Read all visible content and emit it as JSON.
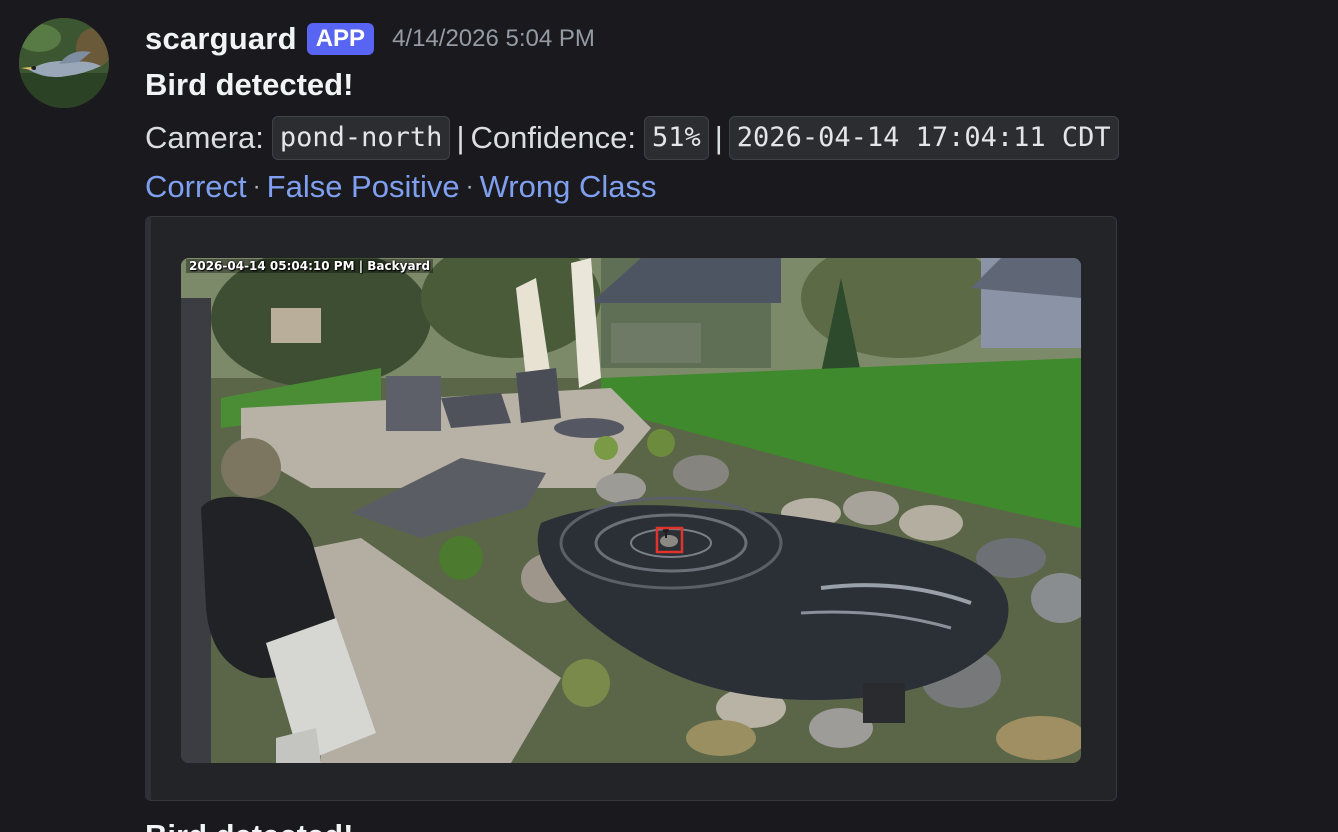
{
  "author": {
    "username": "scarguard",
    "badge": "APP",
    "timestamp": "4/14/2026 5:04 PM",
    "avatar_icon": "heron-avatar"
  },
  "message": {
    "title": "Bird detected!",
    "camera_label": "Camera:",
    "camera_value": "pond-north",
    "separator": "|",
    "confidence_label": "Confidence:",
    "confidence_value": "51%",
    "datetime_value": "2026-04-14 17:04:11 CDT",
    "links": {
      "correct": "Correct",
      "false_positive": "False Positive",
      "wrong_class": "Wrong Class",
      "dot": "·"
    }
  },
  "embed": {
    "image_overlay_text": "2026-04-14 05:04:10 PM | Backyard",
    "detection_box_color": "#e0332b"
  },
  "next_message": {
    "title": "Bird detected!"
  },
  "colors": {
    "background": "#1a1a1e",
    "badge": "#5865f2",
    "link": "#7fa0f0"
  }
}
